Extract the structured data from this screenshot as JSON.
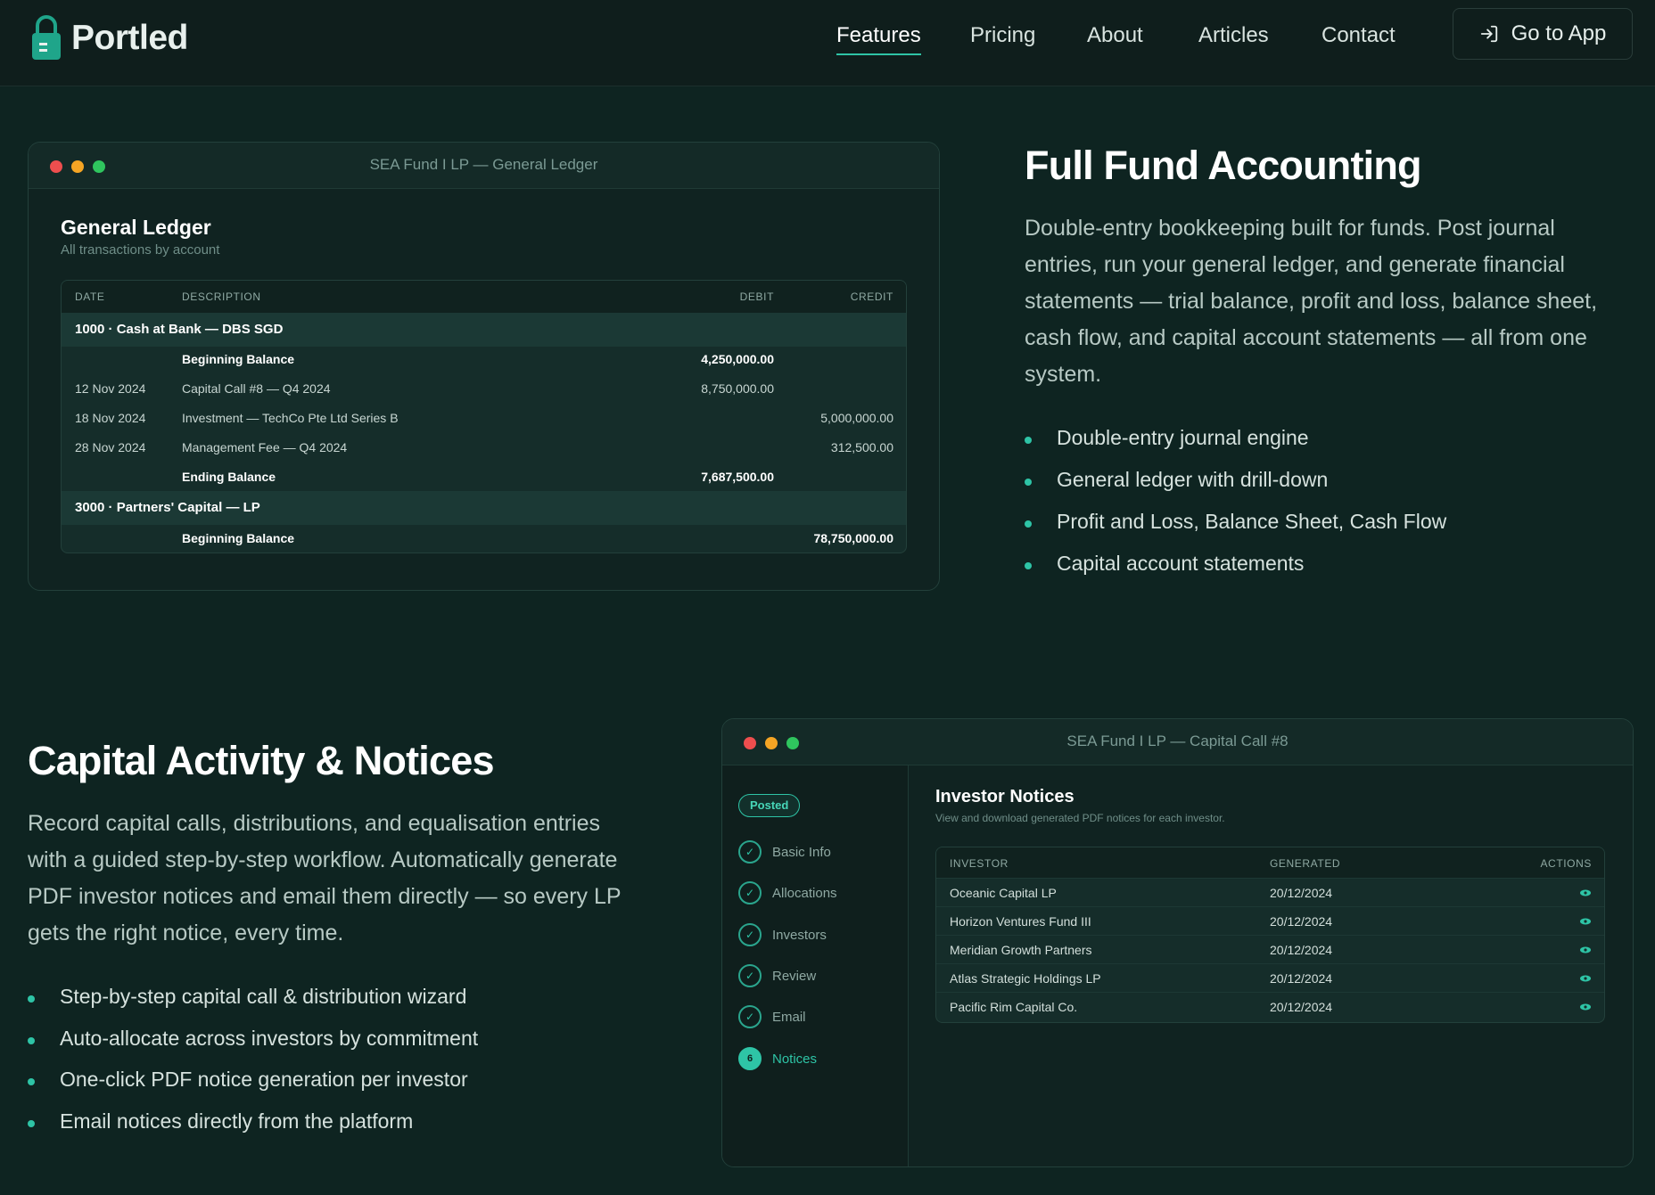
{
  "nav": {
    "brand": "Portled",
    "links": [
      "Features",
      "Pricing",
      "About",
      "Articles",
      "Contact"
    ],
    "active": "Features",
    "cta": "Go to App",
    "accent": "#2ec4a6"
  },
  "fund_accounting": {
    "window_title": "SEA Fund I LP — General Ledger",
    "panel_title": "General Ledger",
    "panel_subtitle": "All transactions by account",
    "columns": [
      "DATE",
      "DESCRIPTION",
      "DEBIT",
      "CREDIT"
    ],
    "groups": [
      {
        "account": "1000 · Cash at Bank — DBS SGD",
        "rows": [
          {
            "date": "",
            "description": "Beginning Balance",
            "debit": "4,250,000.00",
            "credit": "",
            "bold": true
          },
          {
            "date": "12 Nov 2024",
            "description": "Capital Call #8 — Q4 2024",
            "debit": "8,750,000.00",
            "credit": "",
            "bold": false
          },
          {
            "date": "18 Nov 2024",
            "description": "Investment — TechCo Pte Ltd Series B",
            "debit": "",
            "credit": "5,000,000.00",
            "bold": false
          },
          {
            "date": "28 Nov 2024",
            "description": "Management Fee — Q4 2024",
            "debit": "",
            "credit": "312,500.00",
            "bold": false
          },
          {
            "date": "",
            "description": "Ending Balance",
            "debit": "7,687,500.00",
            "credit": "",
            "bold": true
          }
        ]
      },
      {
        "account": "3000 · Partners' Capital — LP",
        "rows": [
          {
            "date": "",
            "description": "Beginning Balance",
            "debit": "",
            "credit": "78,750,000.00",
            "bold": true
          }
        ]
      }
    ],
    "heading": "Full Fund Accounting",
    "body": "Double-entry bookkeeping built for funds. Post journal entries, run your general ledger, and generate financial statements — trial balance, profit and loss, balance sheet, cash flow, and capital account statements — all from one system.",
    "bullets": [
      "Double-entry journal engine",
      "General ledger with drill-down",
      "Profit and Loss, Balance Sheet, Cash Flow",
      "Capital account statements"
    ]
  },
  "capital_activity": {
    "heading": "Capital Activity & Notices",
    "body": "Record capital calls, distributions, and equalisation entries with a guided step-by-step workflow. Automatically generate PDF investor notices and email them directly — so every LP gets the right notice, every time.",
    "bullets": [
      "Step-by-step capital call & distribution wizard",
      "Auto-allocate across investors by commitment",
      "One-click PDF notice generation per investor",
      "Email notices directly from the platform"
    ],
    "window_title": "SEA Fund I LP — Capital Call #8",
    "status": "Posted",
    "steps": [
      {
        "label": "Basic Info",
        "mark": "✓"
      },
      {
        "label": "Allocations",
        "mark": "✓"
      },
      {
        "label": "Investors",
        "mark": "✓"
      },
      {
        "label": "Review",
        "mark": "✓"
      },
      {
        "label": "Email",
        "mark": "✓"
      },
      {
        "label": "Notices",
        "mark": "6"
      }
    ],
    "panel_title": "Investor Notices",
    "panel_subtitle": "View and download generated PDF notices for each investor.",
    "columns": [
      "INVESTOR",
      "GENERATED",
      "ACTIONS"
    ],
    "rows": [
      {
        "investor": "Oceanic Capital LP",
        "generated": "20/12/2024"
      },
      {
        "investor": "Horizon Ventures Fund III",
        "generated": "20/12/2024"
      },
      {
        "investor": "Meridian Growth Partners",
        "generated": "20/12/2024"
      },
      {
        "investor": "Atlas Strategic Holdings LP",
        "generated": "20/12/2024"
      },
      {
        "investor": "Pacific Rim Capital Co.",
        "generated": "20/12/2024"
      }
    ]
  },
  "window_dot_colors": [
    "#ee4e4e",
    "#f5a524",
    "#2fc55e"
  ]
}
